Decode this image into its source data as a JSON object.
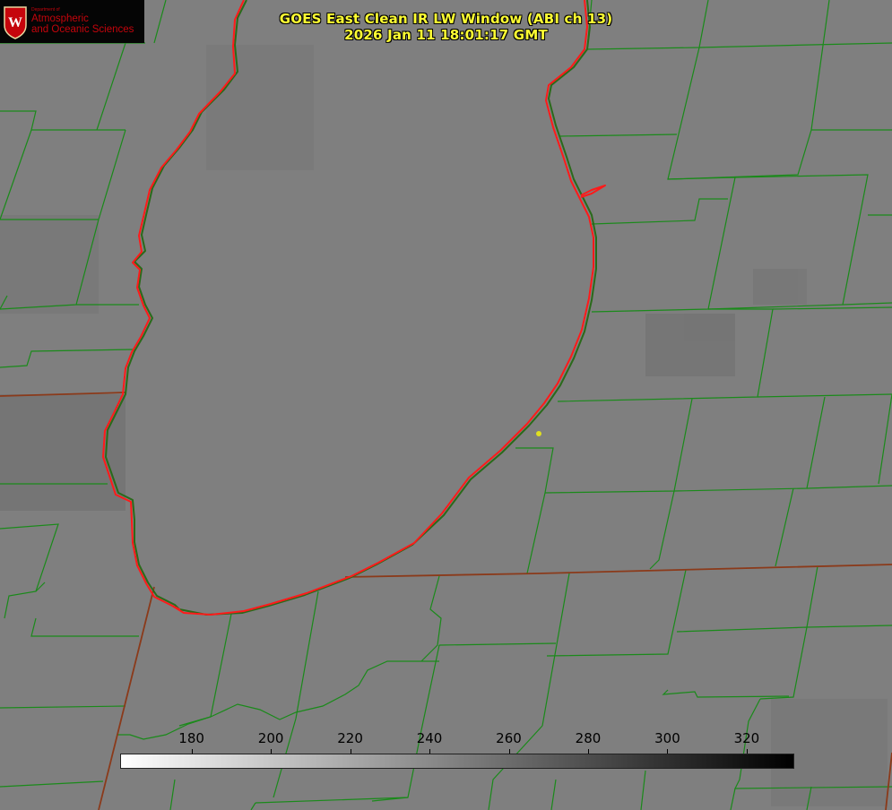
{
  "title": {
    "line1": "GOES East Clean IR LW Window (ABI ch 13)",
    "line2": "2026 Jan 11 18:01:17 GMT"
  },
  "logo": {
    "department": "Department of",
    "line1": "Atmospheric",
    "line2": "and Oceanic Sciences",
    "brand_color": "#c5050c"
  },
  "colorbar": {
    "ticks": [
      "180",
      "200",
      "220",
      "240",
      "260",
      "280",
      "300",
      "320"
    ],
    "range": [
      162,
      332
    ],
    "scale_start_color": "#ffffff",
    "scale_end_color": "#000000"
  },
  "map": {
    "county_line_color": "#1a8a1a",
    "shoreline_color": "#ff1a1a",
    "state_line_color": "#8b3a1a",
    "marker_color": "#e0e020"
  }
}
